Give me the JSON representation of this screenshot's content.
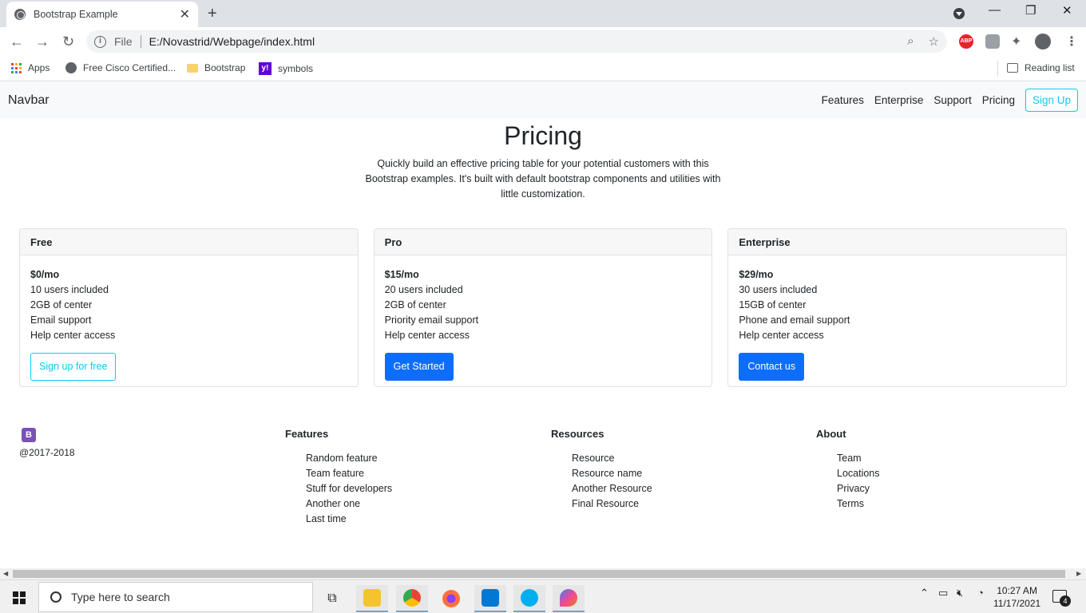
{
  "browser": {
    "tab_title": "Bootstrap Example",
    "tab_close": "✕",
    "new_tab": "+",
    "address_scheme": "File",
    "address_url": "E:/Novastrid/Webpage/index.html",
    "abp_label": "ABP",
    "window_min": "—",
    "window_restore": "❐",
    "window_close": "✕"
  },
  "bookmarks": {
    "apps": "Apps",
    "items": [
      "Free Cisco Certified...",
      "Bootstrap",
      "symbols"
    ],
    "reading_list": "Reading list"
  },
  "navbar": {
    "brand": "Navbar",
    "links": [
      "Features",
      "Enterprise",
      "Support",
      "Pricing"
    ],
    "signup": "Sign Up"
  },
  "hero": {
    "title": "Pricing",
    "description": "Quickly build an effective pricing table for your potential customers with this Bootstrap examples. It's built with default bootstrap components and utilities with little customization."
  },
  "plans": [
    {
      "name": "Free",
      "price": "$0/mo",
      "features": [
        "10 users included",
        "2GB of center",
        "Email support",
        "Help center access"
      ],
      "button": "Sign up for free"
    },
    {
      "name": "Pro",
      "price": "$15/mo",
      "features": [
        "20 users included",
        "2GB of center",
        "Priority email support",
        "Help center access"
      ],
      "button": "Get Started"
    },
    {
      "name": "Enterprise",
      "price": "$29/mo",
      "features": [
        "30 users included",
        "15GB of center",
        "Phone and email support",
        "Help center access"
      ],
      "button": "Contact us"
    }
  ],
  "footer": {
    "logo": "B",
    "copyright": "@2017-2018",
    "columns": [
      {
        "heading": "Features",
        "links": [
          "Random feature",
          "Team feature",
          "Stuff for developers",
          "Another one",
          "Last time"
        ]
      },
      {
        "heading": "Resources",
        "links": [
          "Resource",
          "Resource name",
          "Another Resource",
          "Final Resource"
        ]
      },
      {
        "heading": "About",
        "links": [
          "Team",
          "Locations",
          "Privacy",
          "Terms"
        ]
      }
    ]
  },
  "taskbar": {
    "search_placeholder": "Type here to search",
    "time": "10:27 AM",
    "date": "11/17/2021",
    "notification_count": "4"
  },
  "colors": {
    "primary": "#0d6efd",
    "info": "#0dcaf0",
    "navbar_bg": "#f8f9fa"
  }
}
